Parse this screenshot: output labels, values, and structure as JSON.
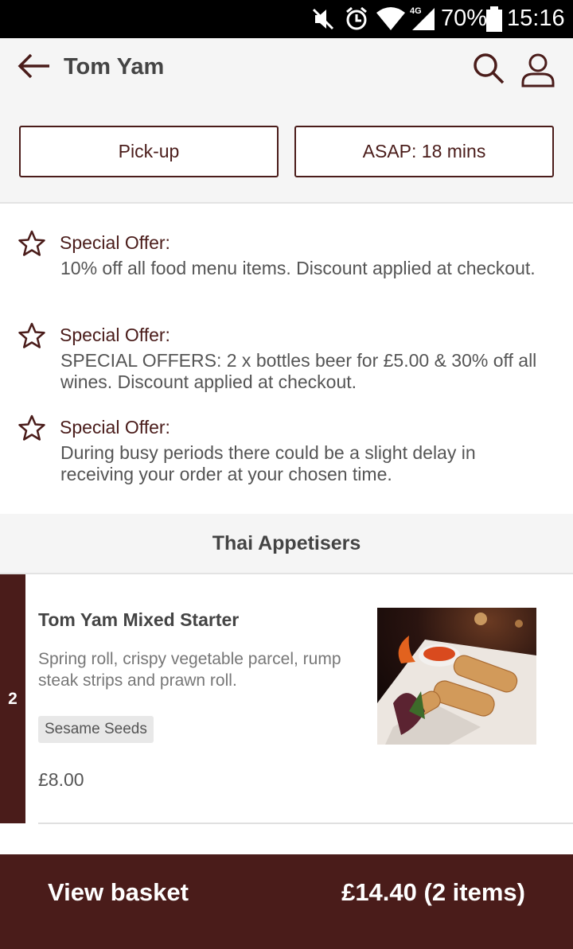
{
  "status_bar": {
    "network": "4G",
    "battery_percent": "70%",
    "time": "15:16"
  },
  "header": {
    "title": "Tom Yam",
    "pickup_label": "Pick-up",
    "time_label": "ASAP: 18 mins",
    "icons": [
      "back-arrow-icon",
      "search-icon",
      "user-icon"
    ]
  },
  "offers": [
    {
      "label": "Special Offer:",
      "text": "10% off all food menu items. Discount applied at checkout."
    },
    {
      "label": "Special Offer:",
      "text": "SPECIAL OFFERS: 2 x bottles beer for £5.00 & 30% off all wines. Discount applied at checkout."
    },
    {
      "label": "Special Offer:",
      "text": "During busy periods there could be a slight delay in receiving your order at your chosen time."
    }
  ],
  "menu": {
    "section_title": "Thai Appetisers",
    "items": [
      {
        "quantity": "2",
        "name": "Tom Yam Mixed Starter",
        "description": "Spring roll, crispy vegetable parcel, rump steak strips and prawn roll.",
        "allergen": "Sesame Seeds",
        "price": "£8.00"
      }
    ]
  },
  "basket": {
    "label": "View basket",
    "total": "£14.40 (2 items)"
  },
  "colors": {
    "brand": "#4a1c1a",
    "header_bg": "#f5f5f5"
  }
}
